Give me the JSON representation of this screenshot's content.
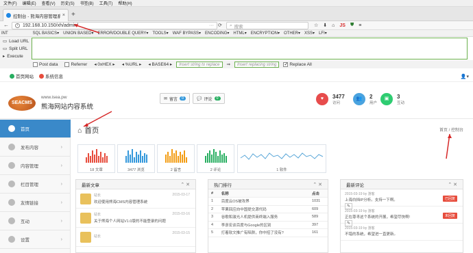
{
  "menu": [
    "文件(F)",
    "编辑(E)",
    "查看(V)",
    "历史(S)",
    "书签(B)",
    "工具(T)",
    "帮助(H)"
  ],
  "tab": {
    "title": "控制台 - 熊海内容管理系统",
    "close": "×",
    "new": "+"
  },
  "url": {
    "value": "192.168.10.150/xh/admin/",
    "search_placeholder": "搜索"
  },
  "ext_icons": [
    "☆",
    "JS",
    "≡"
  ],
  "hackbar": {
    "menus": [
      "INT",
      "SQL BASICS▾",
      "UNION BASED▾",
      "ERROR/DOUBLE QUERY▾",
      "TOOLS▾",
      "WAF BYPASS▾",
      "ENCODING▾",
      "HTML▾",
      "ENCRYPTION▾",
      "OTHER▾",
      "XSS▾",
      "LFI▾"
    ],
    "actions": [
      "Load URL",
      "Split URL",
      "Execute"
    ],
    "options": {
      "post": "Post data",
      "referrer": "Referrer",
      "hex": "0xHEX",
      "url": "%URL",
      "b64": "BASE64",
      "replace_ph": "Insert string to replace",
      "replacing_ph": "Insert replacing string",
      "replace_all": "Replace All"
    }
  },
  "site": {
    "home": "首页网站",
    "logout": "系统信息",
    "url": "www.isea.pw",
    "title": "熊海网站内容系统",
    "logo": "SEACMS"
  },
  "header_btns": [
    {
      "label": "留言",
      "count": "0"
    },
    {
      "label": "评论",
      "count": "0"
    }
  ],
  "stats": [
    {
      "value": "3477",
      "label": "访问",
      "color": "#e74c4c"
    },
    {
      "value": "2",
      "label": "用户",
      "color": "#4aa3df"
    },
    {
      "value": "3",
      "label": "互动",
      "color": "#2ecc71"
    }
  ],
  "sidebar": [
    "首页",
    "发布内容",
    "内容管理",
    "栏目管理",
    "友情链接",
    "互动",
    "设置"
  ],
  "page": {
    "title": "首页",
    "breadcrumb": "首页 / 控制台"
  },
  "tiles": [
    {
      "caption": "18 文章",
      "color": "#e74c3c",
      "bars": [
        0.4,
        0.7,
        0.5,
        0.9,
        0.6,
        1.0,
        0.5,
        0.8,
        0.4,
        0.7,
        0.5
      ]
    },
    {
      "caption": "3477 浏览",
      "color": "#3498db",
      "bars": [
        0.5,
        0.9,
        0.6,
        1.0,
        0.4,
        0.8,
        0.6,
        0.9,
        0.5,
        0.7,
        0.6
      ]
    },
    {
      "caption": "2 留言",
      "color": "#f39c12",
      "bars": [
        0.6,
        0.8,
        0.5,
        1.0,
        0.7,
        0.9,
        0.5,
        0.8,
        0.6,
        0.9,
        0.4
      ]
    },
    {
      "caption": "2 评论",
      "color": "#27ae60",
      "bars": [
        0.5,
        0.7,
        0.9,
        0.6,
        1.0,
        0.8,
        0.5,
        0.9,
        0.6,
        0.7,
        0.5
      ]
    }
  ],
  "soft": {
    "caption": "1 软件"
  },
  "panels": {
    "articles": {
      "title": "最新文章",
      "items": [
        {
          "by": "站长",
          "title": "欢迎使用熊海CMS内容管理系统",
          "date": "2015-03-17"
        },
        {
          "by": "站长",
          "title": "关于熊海个人网站V1.0版的不能登录的问题",
          "date": "2015-03-16"
        },
        {
          "by": "站长",
          "title": "",
          "date": "2015-03-15"
        }
      ]
    },
    "hot": {
      "title": "热门排行",
      "headers": [
        "#",
        "名称",
        "点击"
      ],
      "rows": [
        [
          "1",
          "百度云OS被攻界",
          "1031"
        ],
        [
          "2",
          "苹果回应向中国提交源代码",
          "609"
        ],
        [
          "3",
          "谷歌和激光人机提供商终端入服务",
          "589"
        ],
        [
          "4",
          "李彦宏谈百度与Google的区别",
          "397"
        ],
        [
          "5",
          "打着软文推广有陷阱，你中招了没有?",
          "161"
        ]
      ]
    },
    "comments": {
      "title": "最新评论",
      "items": [
        {
          "by": "2015-03-19 by 游客",
          "text": "上海白挡IP分析。支持一下啊。",
          "status": "已回复"
        },
        {
          "by": "2015-03-19 by 游客",
          "text": "正在尊寻这个系统的开展，希望尽快啊!",
          "status": "未回复"
        },
        {
          "by": "2015-03-19 by 游客",
          "text": "不错的系统，希望进一直更新。",
          "status": ""
        }
      ]
    }
  }
}
